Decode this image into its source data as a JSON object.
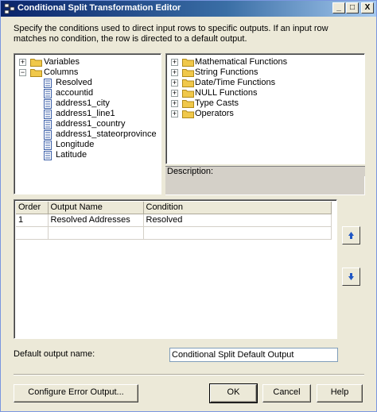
{
  "window": {
    "title": "Conditional Split Transformation Editor",
    "minimize_glyph": "_",
    "maximize_glyph": "□",
    "close_glyph": "X"
  },
  "description": "Specify the conditions used to direct input rows to specific outputs. If an input row matches no condition, the row is directed to a default output.",
  "left_tree": {
    "variables_label": "Variables",
    "columns_label": "Columns",
    "columns": [
      "Resolved",
      "accountid",
      "address1_city",
      "address1_line1",
      "address1_country",
      "address1_stateorprovince",
      "Longitude",
      "Latitude"
    ]
  },
  "right_tree": {
    "items": [
      "Mathematical Functions",
      "String Functions",
      "Date/Time Functions",
      "NULL Functions",
      "Type Casts",
      "Operators"
    ]
  },
  "description_box": {
    "label": "Description:"
  },
  "grid": {
    "headers": {
      "order": "Order",
      "output_name": "Output Name",
      "condition": "Condition"
    },
    "rows": [
      {
        "order": "1",
        "output_name": "Resolved Addresses",
        "condition": "Resolved"
      }
    ]
  },
  "default_output": {
    "label": "Default output name:",
    "value": "Conditional Split Default Output"
  },
  "buttons": {
    "configure_error": "Configure Error Output...",
    "ok": "OK",
    "cancel": "Cancel",
    "help": "Help"
  },
  "colors": {
    "title_start": "#0a246a",
    "title_end": "#a6caf0",
    "folder": "#f0c84a",
    "arrow": "#1f56c4"
  }
}
